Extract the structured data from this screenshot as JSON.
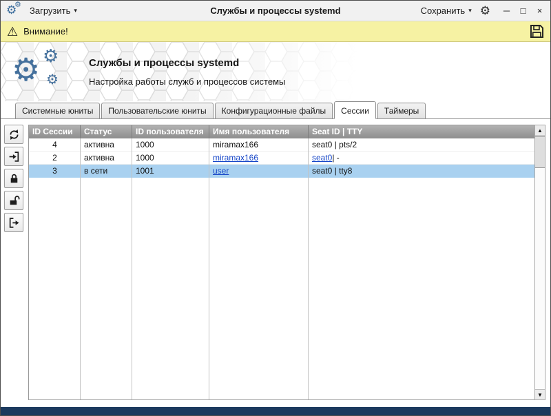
{
  "icons": {
    "gear": "⚙",
    "warning": "⚠",
    "caret": "▾",
    "scroll_up": "▲",
    "scroll_down": "▼",
    "minimize": "─",
    "maximize": "□",
    "close": "×"
  },
  "titlebar": {
    "load_label": "Загрузить",
    "title": "Службы и процессы systemd",
    "save_label": "Сохранить"
  },
  "warning": {
    "text": "Внимание!"
  },
  "banner": {
    "title": "Службы и процессы systemd",
    "subtitle": "Настройка работы служб и процессов системы"
  },
  "tabs": [
    {
      "name": "system-units",
      "label": "Системные юниты",
      "active": false
    },
    {
      "name": "user-units",
      "label": "Пользовательские юниты",
      "active": false
    },
    {
      "name": "config-files",
      "label": "Конфигурационные файлы",
      "active": false
    },
    {
      "name": "sessions",
      "label": "Сессии",
      "active": true
    },
    {
      "name": "timers",
      "label": "Таймеры",
      "active": false
    }
  ],
  "toolbar": {
    "buttons": [
      {
        "name": "refresh"
      },
      {
        "name": "login"
      },
      {
        "name": "lock"
      },
      {
        "name": "unlock"
      },
      {
        "name": "logout"
      }
    ]
  },
  "table": {
    "columns": [
      "ID Сессии",
      "Статус",
      "ID пользователя",
      "Имя пользователя",
      "Seat ID | TTY"
    ],
    "rows": [
      {
        "selected": false,
        "cells": [
          [
            {
              "t": "4"
            }
          ],
          [
            {
              "t": "активна"
            }
          ],
          [
            {
              "t": "1000"
            }
          ],
          [
            {
              "t": "miramax166"
            }
          ],
          [
            {
              "t": "seat0 | pts/2"
            }
          ]
        ]
      },
      {
        "selected": false,
        "cells": [
          [
            {
              "t": "2"
            }
          ],
          [
            {
              "t": "активна"
            }
          ],
          [
            {
              "t": "1000"
            }
          ],
          [
            {
              "t": "miramax166",
              "link": true
            }
          ],
          [
            {
              "t": "seat0",
              "link": true
            },
            {
              "t": " | -"
            }
          ]
        ]
      },
      {
        "selected": true,
        "cells": [
          [
            {
              "t": "3"
            }
          ],
          [
            {
              "t": "в сети"
            }
          ],
          [
            {
              "t": "1001"
            }
          ],
          [
            {
              "t": "user",
              "link": true
            }
          ],
          [
            {
              "t": "seat0 | tty8"
            }
          ]
        ]
      }
    ]
  },
  "colors": {
    "accent_blue": "#45719d",
    "selection": "#a9d1f0",
    "warning_bg": "#f6f2a3",
    "statusbar": "#1b3a5e",
    "link": "#1646c8"
  }
}
